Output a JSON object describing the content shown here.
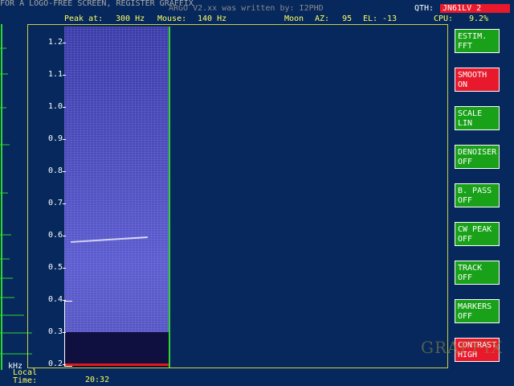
{
  "banner": {
    "line1": "FOR A LOGO-FREE SCREEN, REGISTER GRAFFIX",
    "line2": "ARGO V2.xx was written by: I2PHD",
    "qth_label": "QTH:",
    "qth_value": "JN61LV 2"
  },
  "status": {
    "peak_label": "Peak at:",
    "peak_value": "300 Hz",
    "mouse_label": "Mouse:",
    "mouse_value": "140 Hz",
    "moon_label": "Moon",
    "az_label": "AZ:",
    "az_value": "95",
    "el_label": "EL:",
    "el_value": "-13",
    "cpu_label": "CPU:",
    "cpu_value": "9.2%"
  },
  "axis": {
    "unit": "kHz",
    "ticks": [
      "1.2",
      "1.1",
      "1.0",
      "0.9",
      "0.8",
      "0.7",
      "0.6",
      "0.5",
      "0.4",
      "0.3",
      "0.2"
    ]
  },
  "footer": {
    "local_label_1": "Local",
    "local_label_2": "Time:",
    "time_value": "20:32"
  },
  "buttons": [
    {
      "line1": "ESTIM.",
      "line2": "FFT",
      "state": "green"
    },
    {
      "line1": "SMOOTH",
      "line2": "ON",
      "state": "red"
    },
    {
      "line1": "SCALE",
      "line2": "LIN",
      "state": "green"
    },
    {
      "line1": "DENOISER",
      "line2": "OFF",
      "state": "green"
    },
    {
      "line1": "B. PASS",
      "line2": "OFF",
      "state": "green"
    },
    {
      "line1": "CW PEAK",
      "line2": "OFF",
      "state": "green"
    },
    {
      "line1": "TRACK",
      "line2": "OFF",
      "state": "green"
    },
    {
      "line1": "MARKERS",
      "line2": "OFF",
      "state": "green"
    },
    {
      "line1": "CONTRAST",
      "line2": "HIGH",
      "state": "red"
    }
  ],
  "watermark": "GRAFFIX",
  "colors": {
    "background": "#06285c",
    "button_green": "#19a119",
    "button_red": "#e8192c",
    "status_text": "#ffff60",
    "cursor": "#2fd62f"
  }
}
